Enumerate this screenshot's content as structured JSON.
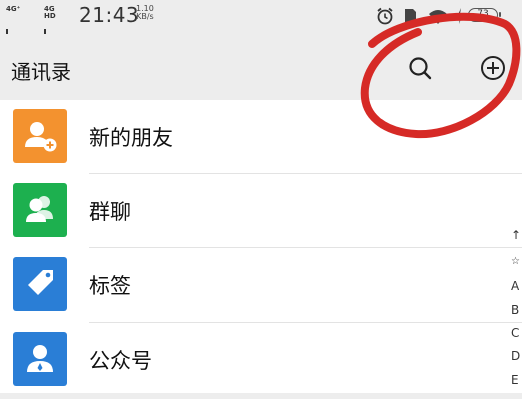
{
  "status_bar": {
    "network1": "4G⁺",
    "network2": "4G HD",
    "time": "21:43",
    "speed_value": "1.10",
    "speed_unit": "KB/s",
    "battery": "73"
  },
  "header": {
    "title": "通讯录",
    "search_icon": "search-icon",
    "add_icon": "plus-circle-icon"
  },
  "list": {
    "items": [
      {
        "label": "新的朋友",
        "icon": "add-friend-icon",
        "color": "#f3922f"
      },
      {
        "label": "群聊",
        "icon": "group-icon",
        "color": "#1db04f"
      },
      {
        "label": "标签",
        "icon": "tag-icon",
        "color": "#2a7ed6"
      },
      {
        "label": "公众号",
        "icon": "official-account-icon",
        "color": "#2a7ed6"
      }
    ]
  },
  "index_bar": {
    "letters": [
      "↑",
      "☆",
      "A",
      "B",
      "C",
      "D",
      "E"
    ]
  },
  "colors": {
    "background": "#ededed",
    "list_background": "#ffffff",
    "annotation_red": "#d62a26"
  }
}
